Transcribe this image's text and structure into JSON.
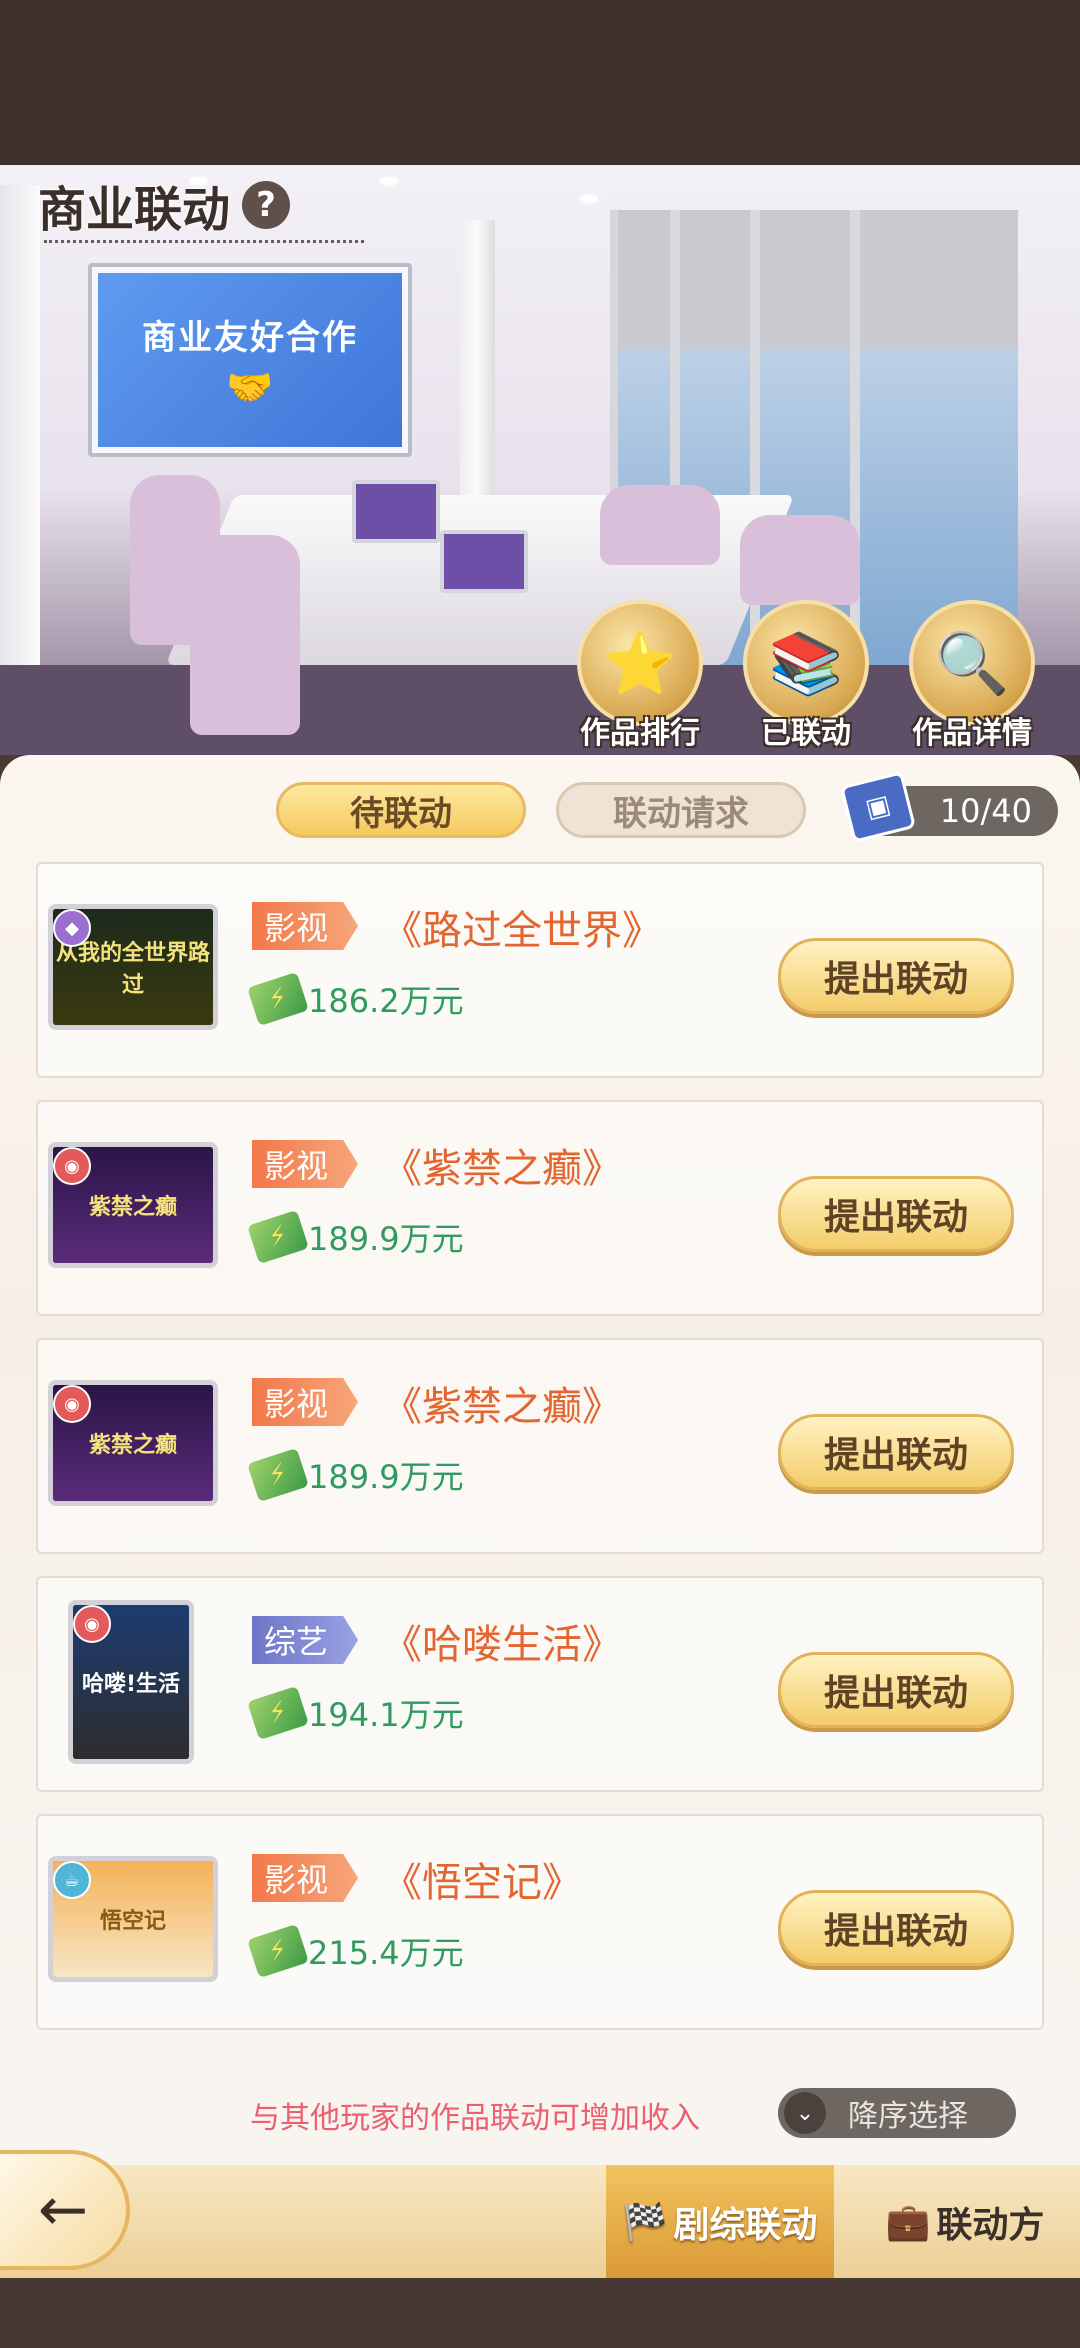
{
  "header": {
    "title": "商业联动",
    "help_symbol": "?"
  },
  "scene": {
    "tv_text": "商业友好合作"
  },
  "features": [
    {
      "label": "作品排行",
      "icon": "trophy-star"
    },
    {
      "label": "已联动",
      "icon": "books"
    },
    {
      "label": "作品详情",
      "icon": "magnifier"
    }
  ],
  "tabs": {
    "pending": "待联动",
    "requests": "联动请求"
  },
  "counter": {
    "value": "10/40",
    "icon": "tv-screen"
  },
  "works": [
    {
      "type": "影视",
      "title": "《路过全世界》",
      "income": "186.2万元",
      "button": "提出联动",
      "poster_text": "从我的全世界路过"
    },
    {
      "type": "影视",
      "title": "《紫禁之癫》",
      "income": "189.9万元",
      "button": "提出联动",
      "poster_text": "紫禁之癫"
    },
    {
      "type": "影视",
      "title": "《紫禁之癫》",
      "income": "189.9万元",
      "button": "提出联动",
      "poster_text": "紫禁之癫"
    },
    {
      "type": "综艺",
      "title": "《哈喽生活》",
      "income": "194.1万元",
      "button": "提出联动",
      "poster_text": "哈喽!生活"
    },
    {
      "type": "影视",
      "title": "《悟空记》",
      "income": "215.4万元",
      "button": "提出联动",
      "poster_text": "悟空记"
    }
  ],
  "hint": "与其他玩家的作品联动可增加收入",
  "sort": {
    "label": "降序选择"
  },
  "bottom_nav": {
    "back": "←",
    "drama_link": "剧综联动",
    "partner": "联动方"
  },
  "colors": {
    "accent": "#e3652f",
    "income": "#2f9b5f",
    "film_tag": "#f2784a",
    "variety_tag": "#6d75c9",
    "hint": "#ec5f6f"
  }
}
